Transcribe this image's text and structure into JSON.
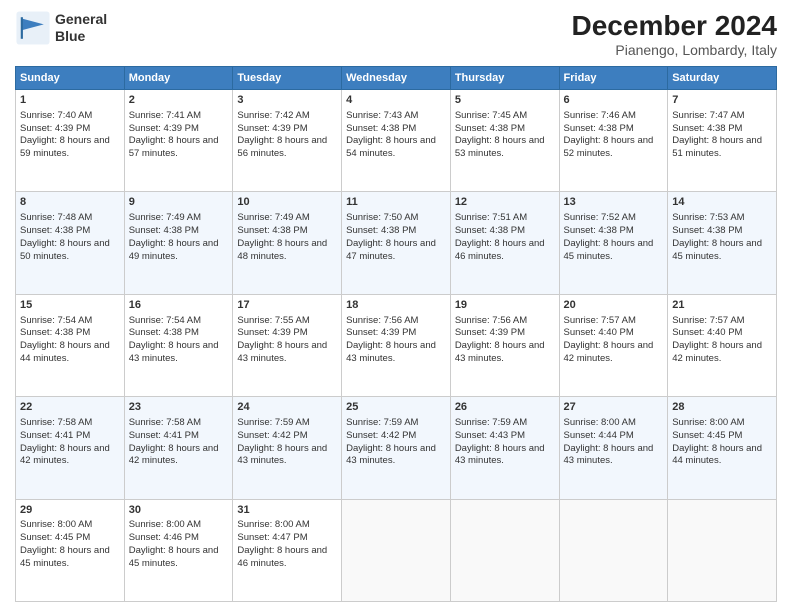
{
  "header": {
    "logo_line1": "General",
    "logo_line2": "Blue",
    "month_title": "December 2024",
    "location": "Pianengo, Lombardy, Italy"
  },
  "days_of_week": [
    "Sunday",
    "Monday",
    "Tuesday",
    "Wednesday",
    "Thursday",
    "Friday",
    "Saturday"
  ],
  "weeks": [
    [
      {
        "day": "1",
        "sunrise": "Sunrise: 7:40 AM",
        "sunset": "Sunset: 4:39 PM",
        "daylight": "Daylight: 8 hours and 59 minutes."
      },
      {
        "day": "2",
        "sunrise": "Sunrise: 7:41 AM",
        "sunset": "Sunset: 4:39 PM",
        "daylight": "Daylight: 8 hours and 57 minutes."
      },
      {
        "day": "3",
        "sunrise": "Sunrise: 7:42 AM",
        "sunset": "Sunset: 4:39 PM",
        "daylight": "Daylight: 8 hours and 56 minutes."
      },
      {
        "day": "4",
        "sunrise": "Sunrise: 7:43 AM",
        "sunset": "Sunset: 4:38 PM",
        "daylight": "Daylight: 8 hours and 54 minutes."
      },
      {
        "day": "5",
        "sunrise": "Sunrise: 7:45 AM",
        "sunset": "Sunset: 4:38 PM",
        "daylight": "Daylight: 8 hours and 53 minutes."
      },
      {
        "day": "6",
        "sunrise": "Sunrise: 7:46 AM",
        "sunset": "Sunset: 4:38 PM",
        "daylight": "Daylight: 8 hours and 52 minutes."
      },
      {
        "day": "7",
        "sunrise": "Sunrise: 7:47 AM",
        "sunset": "Sunset: 4:38 PM",
        "daylight": "Daylight: 8 hours and 51 minutes."
      }
    ],
    [
      {
        "day": "8",
        "sunrise": "Sunrise: 7:48 AM",
        "sunset": "Sunset: 4:38 PM",
        "daylight": "Daylight: 8 hours and 50 minutes."
      },
      {
        "day": "9",
        "sunrise": "Sunrise: 7:49 AM",
        "sunset": "Sunset: 4:38 PM",
        "daylight": "Daylight: 8 hours and 49 minutes."
      },
      {
        "day": "10",
        "sunrise": "Sunrise: 7:49 AM",
        "sunset": "Sunset: 4:38 PM",
        "daylight": "Daylight: 8 hours and 48 minutes."
      },
      {
        "day": "11",
        "sunrise": "Sunrise: 7:50 AM",
        "sunset": "Sunset: 4:38 PM",
        "daylight": "Daylight: 8 hours and 47 minutes."
      },
      {
        "day": "12",
        "sunrise": "Sunrise: 7:51 AM",
        "sunset": "Sunset: 4:38 PM",
        "daylight": "Daylight: 8 hours and 46 minutes."
      },
      {
        "day": "13",
        "sunrise": "Sunrise: 7:52 AM",
        "sunset": "Sunset: 4:38 PM",
        "daylight": "Daylight: 8 hours and 45 minutes."
      },
      {
        "day": "14",
        "sunrise": "Sunrise: 7:53 AM",
        "sunset": "Sunset: 4:38 PM",
        "daylight": "Daylight: 8 hours and 45 minutes."
      }
    ],
    [
      {
        "day": "15",
        "sunrise": "Sunrise: 7:54 AM",
        "sunset": "Sunset: 4:38 PM",
        "daylight": "Daylight: 8 hours and 44 minutes."
      },
      {
        "day": "16",
        "sunrise": "Sunrise: 7:54 AM",
        "sunset": "Sunset: 4:38 PM",
        "daylight": "Daylight: 8 hours and 43 minutes."
      },
      {
        "day": "17",
        "sunrise": "Sunrise: 7:55 AM",
        "sunset": "Sunset: 4:39 PM",
        "daylight": "Daylight: 8 hours and 43 minutes."
      },
      {
        "day": "18",
        "sunrise": "Sunrise: 7:56 AM",
        "sunset": "Sunset: 4:39 PM",
        "daylight": "Daylight: 8 hours and 43 minutes."
      },
      {
        "day": "19",
        "sunrise": "Sunrise: 7:56 AM",
        "sunset": "Sunset: 4:39 PM",
        "daylight": "Daylight: 8 hours and 43 minutes."
      },
      {
        "day": "20",
        "sunrise": "Sunrise: 7:57 AM",
        "sunset": "Sunset: 4:40 PM",
        "daylight": "Daylight: 8 hours and 42 minutes."
      },
      {
        "day": "21",
        "sunrise": "Sunrise: 7:57 AM",
        "sunset": "Sunset: 4:40 PM",
        "daylight": "Daylight: 8 hours and 42 minutes."
      }
    ],
    [
      {
        "day": "22",
        "sunrise": "Sunrise: 7:58 AM",
        "sunset": "Sunset: 4:41 PM",
        "daylight": "Daylight: 8 hours and 42 minutes."
      },
      {
        "day": "23",
        "sunrise": "Sunrise: 7:58 AM",
        "sunset": "Sunset: 4:41 PM",
        "daylight": "Daylight: 8 hours and 42 minutes."
      },
      {
        "day": "24",
        "sunrise": "Sunrise: 7:59 AM",
        "sunset": "Sunset: 4:42 PM",
        "daylight": "Daylight: 8 hours and 43 minutes."
      },
      {
        "day": "25",
        "sunrise": "Sunrise: 7:59 AM",
        "sunset": "Sunset: 4:42 PM",
        "daylight": "Daylight: 8 hours and 43 minutes."
      },
      {
        "day": "26",
        "sunrise": "Sunrise: 7:59 AM",
        "sunset": "Sunset: 4:43 PM",
        "daylight": "Daylight: 8 hours and 43 minutes."
      },
      {
        "day": "27",
        "sunrise": "Sunrise: 8:00 AM",
        "sunset": "Sunset: 4:44 PM",
        "daylight": "Daylight: 8 hours and 43 minutes."
      },
      {
        "day": "28",
        "sunrise": "Sunrise: 8:00 AM",
        "sunset": "Sunset: 4:45 PM",
        "daylight": "Daylight: 8 hours and 44 minutes."
      }
    ],
    [
      {
        "day": "29",
        "sunrise": "Sunrise: 8:00 AM",
        "sunset": "Sunset: 4:45 PM",
        "daylight": "Daylight: 8 hours and 45 minutes."
      },
      {
        "day": "30",
        "sunrise": "Sunrise: 8:00 AM",
        "sunset": "Sunset: 4:46 PM",
        "daylight": "Daylight: 8 hours and 45 minutes."
      },
      {
        "day": "31",
        "sunrise": "Sunrise: 8:00 AM",
        "sunset": "Sunset: 4:47 PM",
        "daylight": "Daylight: 8 hours and 46 minutes."
      },
      null,
      null,
      null,
      null
    ]
  ]
}
